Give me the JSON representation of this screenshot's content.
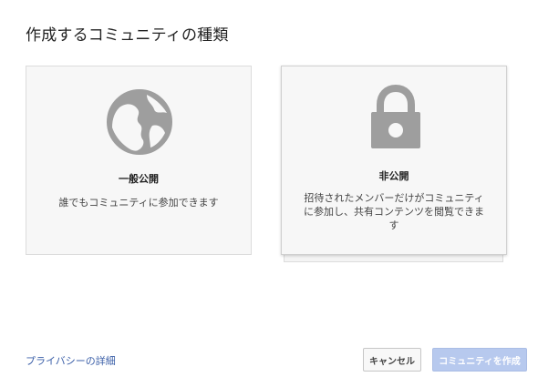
{
  "dialog": {
    "title": "作成するコミュニティの種類"
  },
  "options": {
    "public": {
      "icon": "globe-icon",
      "title": "一般公開",
      "description": "誰でもコミュニティに参加できます"
    },
    "private": {
      "icon": "lock-icon",
      "title": "非公開",
      "description": "招待されたメンバーだけがコミュニティに参加し、共有コンテンツを閲覧できます"
    }
  },
  "footer": {
    "privacy_link": "プライバシーの詳細",
    "cancel_label": "キャンセル",
    "create_label": "コミュニティを作成"
  },
  "colors": {
    "icon_gray": "#9e9e9e",
    "link_blue": "#3b5fa8",
    "create_button_disabled": "#b7c9ee"
  }
}
